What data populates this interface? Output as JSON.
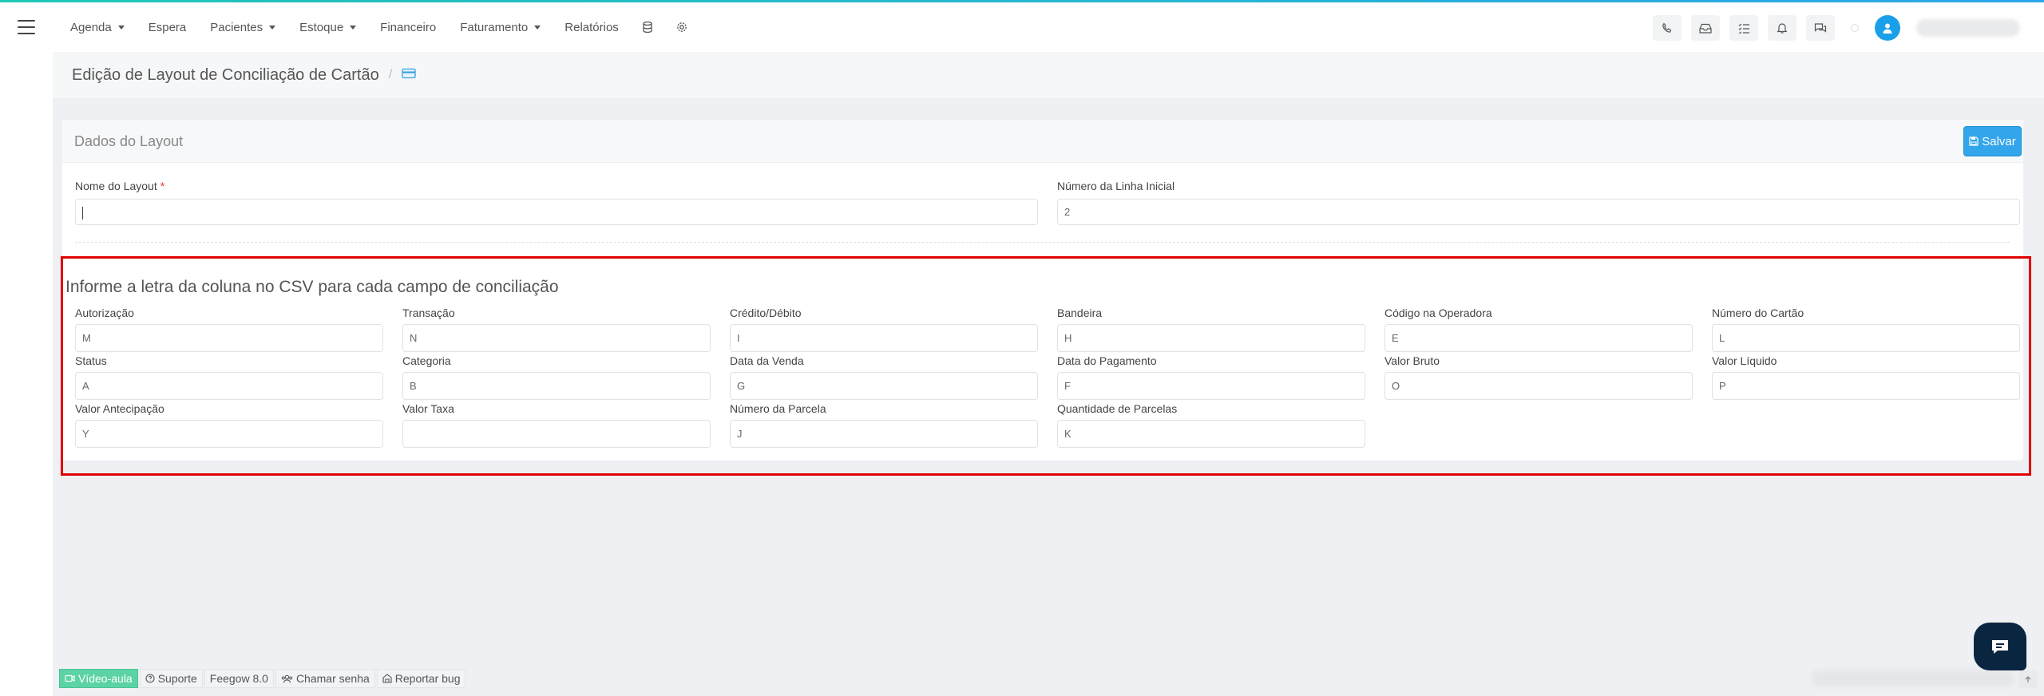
{
  "nav": {
    "items": [
      {
        "label": "Agenda",
        "dropdown": true
      },
      {
        "label": "Espera",
        "dropdown": false
      },
      {
        "label": "Pacientes",
        "dropdown": true
      },
      {
        "label": "Estoque",
        "dropdown": true
      },
      {
        "label": "Financeiro",
        "dropdown": false
      },
      {
        "label": "Faturamento",
        "dropdown": true
      },
      {
        "label": "Relatórios",
        "dropdown": false
      }
    ],
    "icons": [
      "database-icon",
      "gear-icon"
    ],
    "right_icons": [
      "phone-icon",
      "inbox-icon",
      "checklist-icon",
      "bell-icon",
      "chat-icon"
    ]
  },
  "page": {
    "title": "Edição de Layout de Conciliação de Cartão",
    "breadcrumb_sep": "/",
    "breadcrumb_icon": "credit-card-icon"
  },
  "panel": {
    "title": "Dados do Layout",
    "save_label": "Salvar",
    "name_label": "Nome do Layout",
    "required_mark": "*",
    "name_value": "",
    "start_line_label": "Número da Linha Inicial",
    "start_line_value": "2"
  },
  "mapping": {
    "title": "Informe a letra da coluna no CSV para cada campo de conciliação",
    "fields": [
      {
        "label": "Autorização",
        "value": "M"
      },
      {
        "label": "Transação",
        "value": "N"
      },
      {
        "label": "Crédito/Débito",
        "value": "I"
      },
      {
        "label": "Bandeira",
        "value": "H"
      },
      {
        "label": "Código na Operadora",
        "value": "E"
      },
      {
        "label": "Número do Cartão",
        "value": "L"
      },
      {
        "label": "Status",
        "value": "A"
      },
      {
        "label": "Categoria",
        "value": "B"
      },
      {
        "label": "Data da Venda",
        "value": "G"
      },
      {
        "label": "Data do Pagamento",
        "value": "F"
      },
      {
        "label": "Valor Bruto",
        "value": "O"
      },
      {
        "label": "Valor Líquido",
        "value": "P"
      },
      {
        "label": "Valor Antecipação",
        "value": "Y"
      },
      {
        "label": "Valor Taxa",
        "value": ""
      },
      {
        "label": "Número da Parcela",
        "value": "J"
      },
      {
        "label": "Quantidade de Parcelas",
        "value": "K"
      }
    ]
  },
  "footer": {
    "video": "Vídeo-aula",
    "support": "Suporte",
    "version": "Feegow 8.0",
    "call": "Chamar senha",
    "bug": "Reportar bug"
  },
  "colors": {
    "primary": "#33a5ea",
    "accent_green": "#5cd3a4",
    "highlight_red": "#e00000",
    "chat_dark": "#0a2540"
  }
}
